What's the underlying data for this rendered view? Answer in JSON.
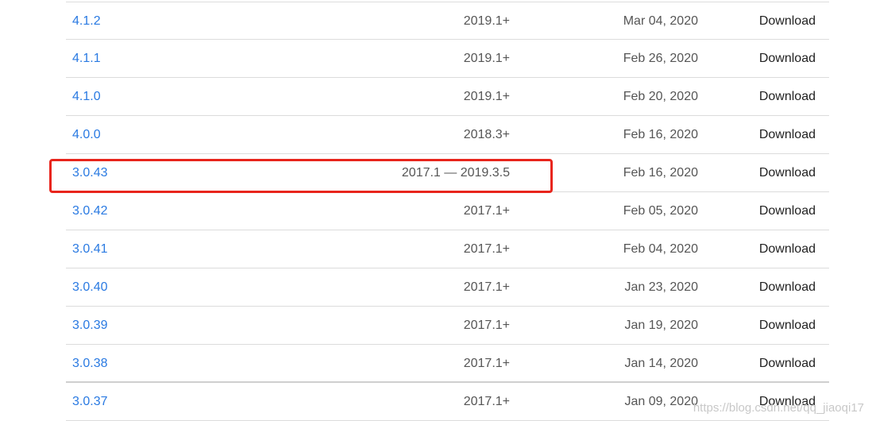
{
  "releases": [
    {
      "version": "4.1.2",
      "compat": "2019.1+",
      "date": "Mar 04, 2020",
      "action": "Download"
    },
    {
      "version": "4.1.1",
      "compat": "2019.1+",
      "date": "Feb 26, 2020",
      "action": "Download"
    },
    {
      "version": "4.1.0",
      "compat": "2019.1+",
      "date": "Feb 20, 2020",
      "action": "Download"
    },
    {
      "version": "4.0.0",
      "compat": "2018.3+",
      "date": "Feb 16, 2020",
      "action": "Download"
    },
    {
      "version": "3.0.43",
      "compat": "2017.1 — 2019.3.5",
      "date": "Feb 16, 2020",
      "action": "Download"
    },
    {
      "version": "3.0.42",
      "compat": "2017.1+",
      "date": "Feb 05, 2020",
      "action": "Download"
    },
    {
      "version": "3.0.41",
      "compat": "2017.1+",
      "date": "Feb 04, 2020",
      "action": "Download"
    },
    {
      "version": "3.0.40",
      "compat": "2017.1+",
      "date": "Jan 23, 2020",
      "action": "Download"
    },
    {
      "version": "3.0.39",
      "compat": "2017.1+",
      "date": "Jan 19, 2020",
      "action": "Download"
    },
    {
      "version": "3.0.38",
      "compat": "2017.1+",
      "date": "Jan 14, 2020",
      "action": "Download"
    },
    {
      "version": "3.0.37",
      "compat": "2017.1+",
      "date": "Jan 09, 2020",
      "action": "Download"
    }
  ],
  "highlighted_release": "3.0.43",
  "watermark": "https://blog.csdn.net/qq_jiaoqi17",
  "colors": {
    "link": "#2a7ae2",
    "text_muted": "#555555",
    "text_dark": "#222222",
    "highlight_border": "#e8251c",
    "row_divider": "#dcdcdc"
  }
}
